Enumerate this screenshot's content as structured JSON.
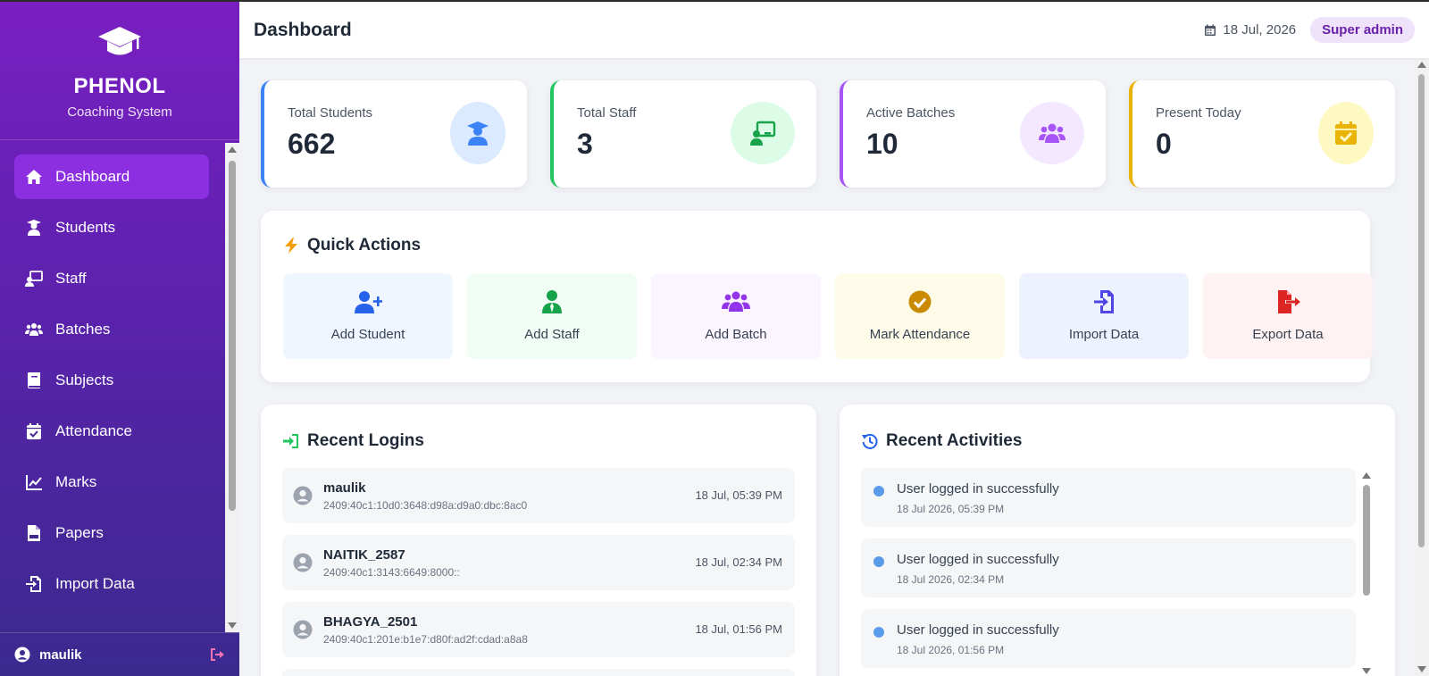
{
  "brand": {
    "name": "PHENOL",
    "subtitle": "Coaching System",
    "icon": "graduation-cap-icon"
  },
  "sidebar": {
    "items": [
      {
        "label": "Dashboard",
        "icon": "home-icon",
        "active": true
      },
      {
        "label": "Students",
        "icon": "student-icon"
      },
      {
        "label": "Staff",
        "icon": "teacher-icon"
      },
      {
        "label": "Batches",
        "icon": "users-icon"
      },
      {
        "label": "Subjects",
        "icon": "book-icon"
      },
      {
        "label": "Attendance",
        "icon": "calendar-check-icon"
      },
      {
        "label": "Marks",
        "icon": "chart-line-icon"
      },
      {
        "label": "Papers",
        "icon": "pdf-file-icon"
      },
      {
        "label": "Import Data",
        "icon": "file-import-icon"
      }
    ],
    "user": {
      "name": "maulik"
    }
  },
  "header": {
    "title": "Dashboard",
    "date": "18 Jul, 2026",
    "role": "Super admin"
  },
  "stats": [
    {
      "label": "Total Students",
      "value": "662",
      "icon": "graduation-student-icon",
      "color": "#3b82f6",
      "bg": "#dbeafe"
    },
    {
      "label": "Total Staff",
      "value": "3",
      "icon": "teacher-board-icon",
      "color": "#22c55e",
      "bg": "#dcfce7"
    },
    {
      "label": "Active Batches",
      "value": "10",
      "icon": "users-icon",
      "color": "#a855f7",
      "bg": "#f3e8ff"
    },
    {
      "label": "Present Today",
      "value": "0",
      "icon": "calendar-check-icon",
      "color": "#eab308",
      "bg": "#fef9c3"
    }
  ],
  "quick_actions": {
    "title": "Quick Actions",
    "items": [
      {
        "label": "Add Student",
        "icon": "user-plus-icon",
        "color": "#2563eb",
        "bg": "#eff6ff"
      },
      {
        "label": "Add Staff",
        "icon": "user-tie-icon",
        "color": "#16a34a",
        "bg": "#f0fdf4"
      },
      {
        "label": "Add Batch",
        "icon": "users-icon",
        "color": "#9333ea",
        "bg": "#faf5ff"
      },
      {
        "label": "Mark Attendance",
        "icon": "check-circle-icon",
        "color": "#ca8a04",
        "bg": "#fefce8"
      },
      {
        "label": "Import Data",
        "icon": "file-import-icon",
        "color": "#4f46e5",
        "bg": "#eef2ff"
      },
      {
        "label": "Export Data",
        "icon": "file-export-icon",
        "color": "#dc2626",
        "bg": "#fef2f2"
      }
    ]
  },
  "recent_logins": {
    "title": "Recent Logins",
    "items": [
      {
        "name": "maulik",
        "ip": "2409:40c1:10d0:3648:d98a:d9a0:dbc:8ac0",
        "time": "18 Jul, 05:39 PM"
      },
      {
        "name": "NAITIK_2587",
        "ip": "2409:40c1:3143:6649:8000::",
        "time": "18 Jul, 02:34 PM"
      },
      {
        "name": "BHAGYA_2501",
        "ip": "2409:40c1:201e:b1e7:d80f:ad2f:cdad:a8a8",
        "time": "18 Jul, 01:56 PM"
      }
    ]
  },
  "recent_activities": {
    "title": "Recent Activities",
    "items": [
      {
        "text": "User logged in successfully",
        "date": "18 Jul 2026, 05:39 PM"
      },
      {
        "text": "User logged in successfully",
        "date": "18 Jul 2026, 02:34 PM"
      },
      {
        "text": "User logged in successfully",
        "date": "18 Jul 2026, 01:56 PM"
      }
    ]
  }
}
